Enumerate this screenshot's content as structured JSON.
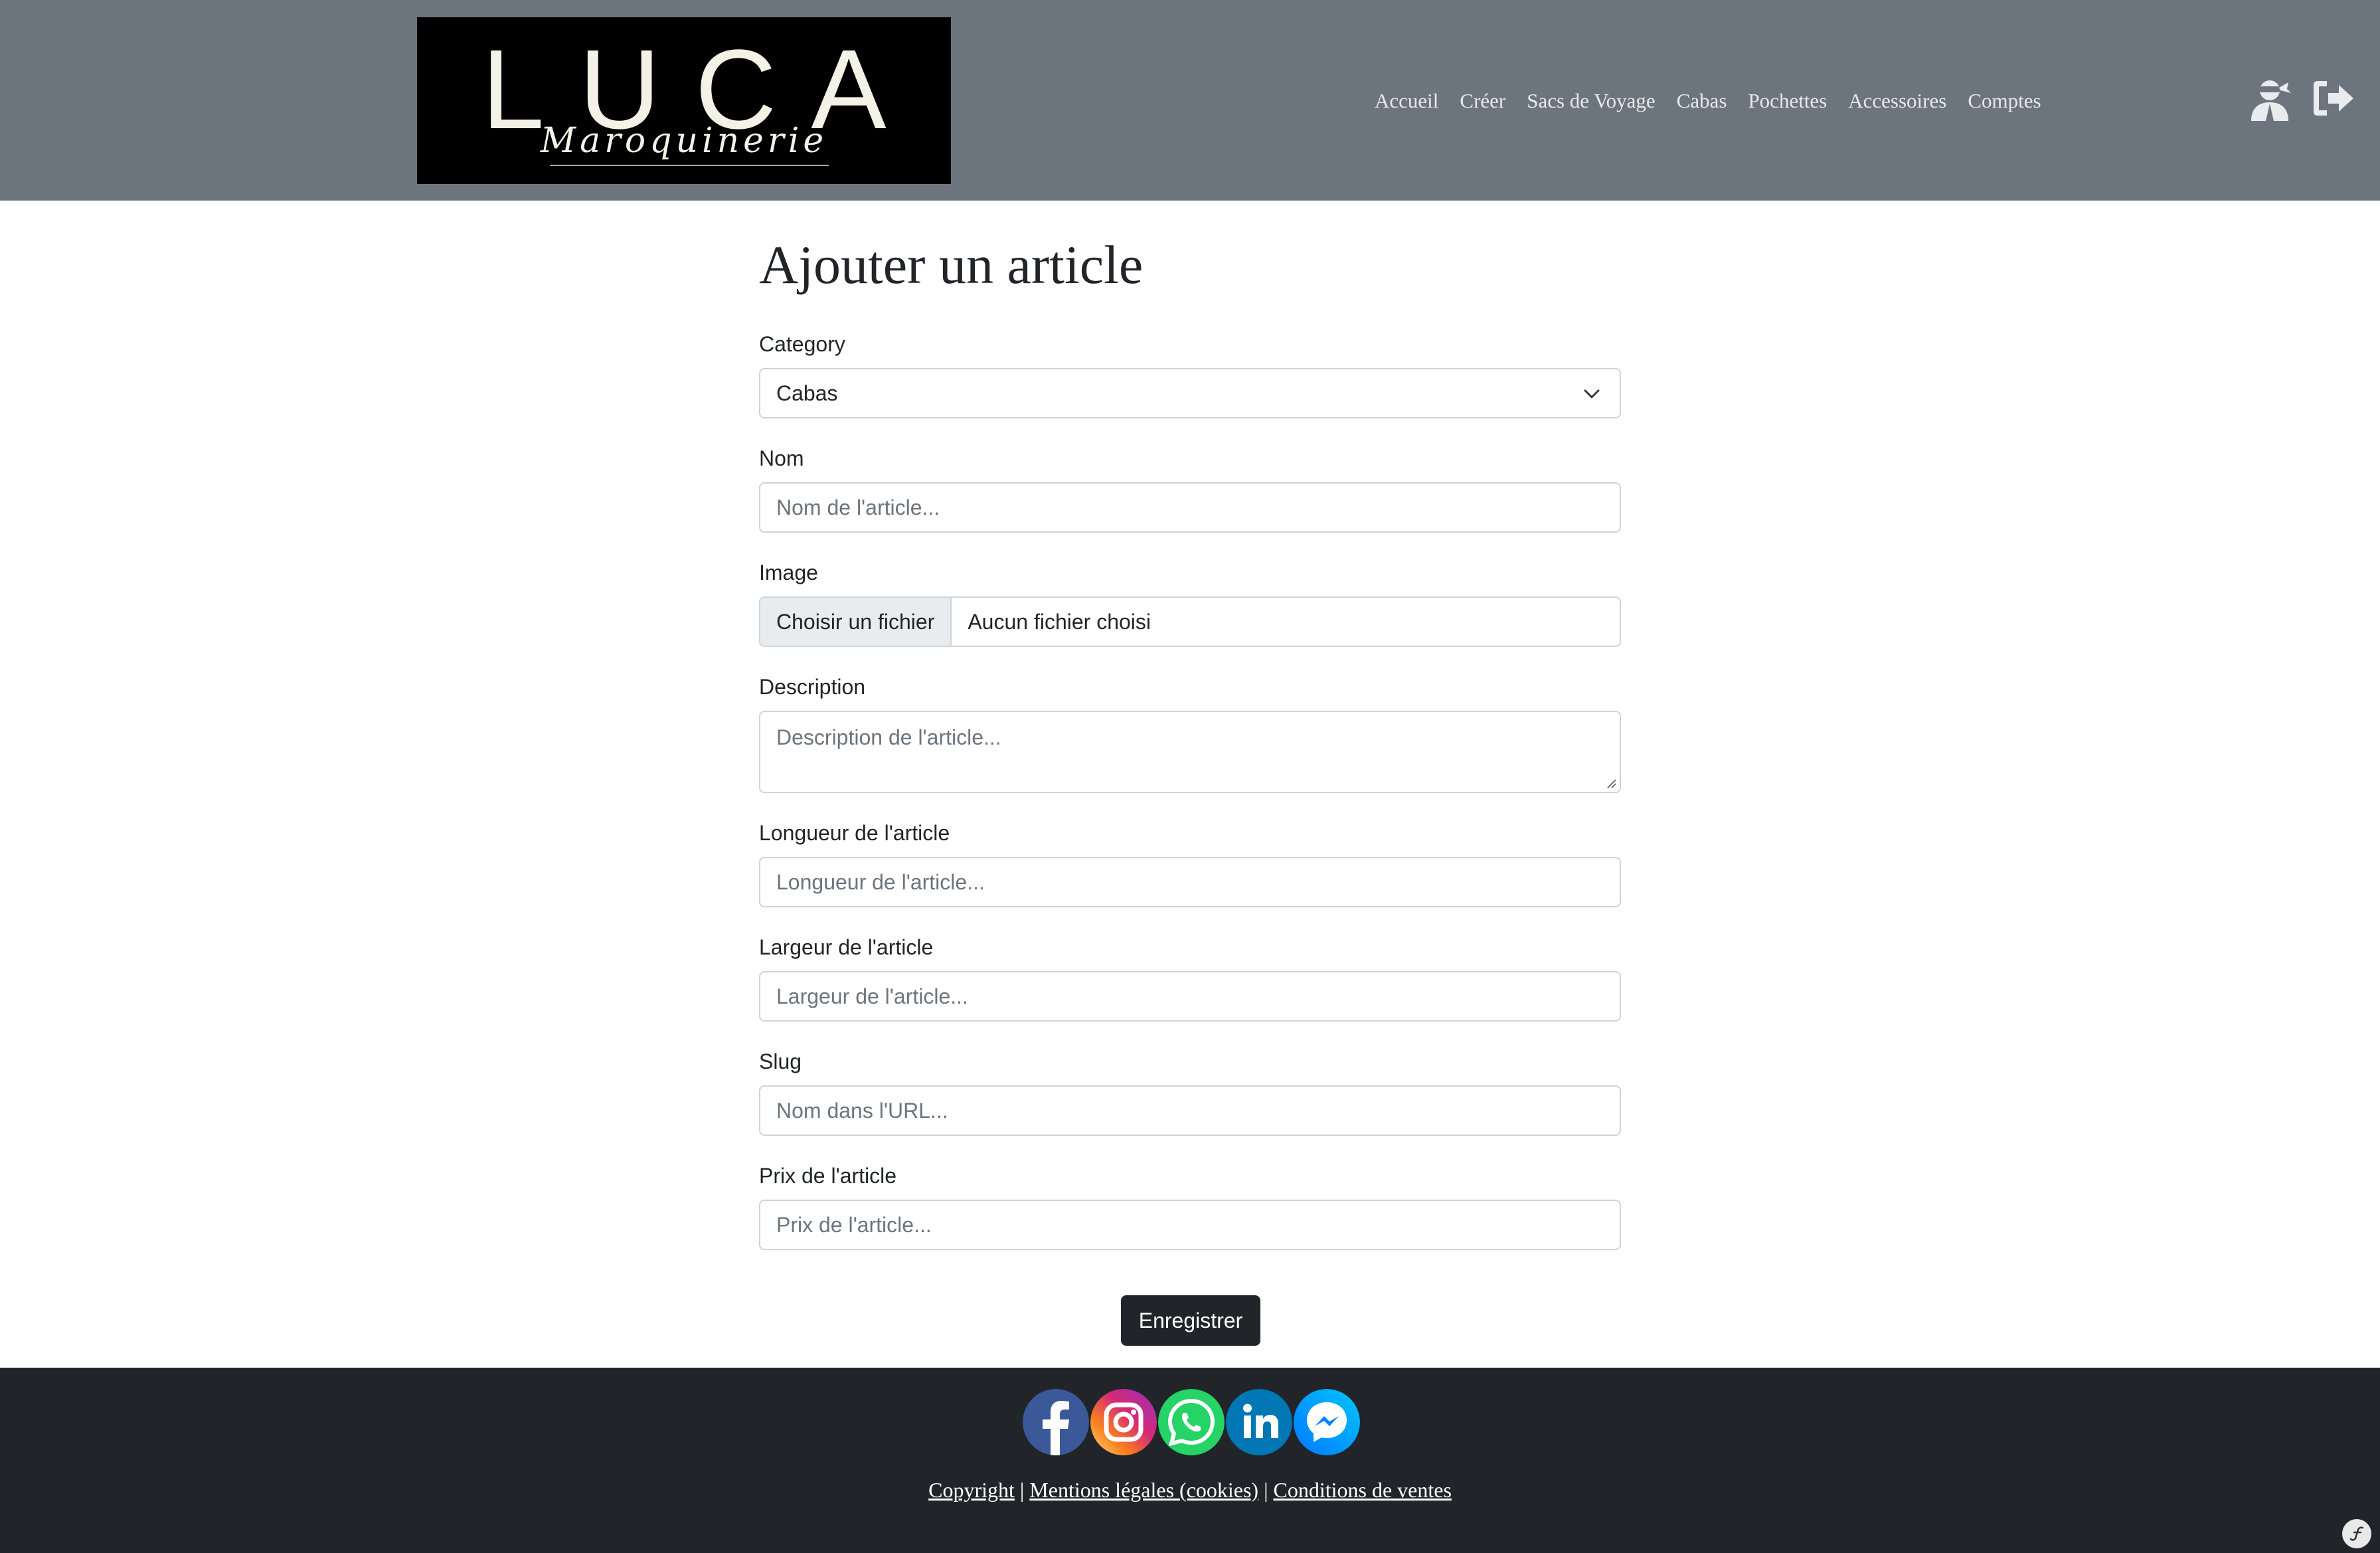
{
  "header": {
    "logo": {
      "wordmark": "LUCA",
      "tagline": "Maroquinerie"
    },
    "nav": [
      {
        "label": "Accueil"
      },
      {
        "label": "Créer"
      },
      {
        "label": "Sacs de Voyage"
      },
      {
        "label": "Cabas"
      },
      {
        "label": "Pochettes"
      },
      {
        "label": "Accessoires"
      },
      {
        "label": "Comptes"
      }
    ],
    "icons": [
      "user-ninja-icon",
      "sign-out-icon"
    ]
  },
  "form": {
    "title": "Ajouter un article",
    "category": {
      "label": "Category",
      "value": "Cabas"
    },
    "nom": {
      "label": "Nom",
      "placeholder": "Nom de l'article..."
    },
    "image": {
      "label": "Image",
      "button": "Choisir un fichier",
      "file_status": "Aucun fichier choisi"
    },
    "description": {
      "label": "Description",
      "placeholder": "Description de l'article..."
    },
    "longueur": {
      "label": "Longueur de l'article",
      "placeholder": "Longueur de l'article..."
    },
    "largeur": {
      "label": "Largeur de l'article",
      "placeholder": "Largeur de l'article..."
    },
    "slug": {
      "label": "Slug",
      "placeholder": "Nom dans l'URL..."
    },
    "prix": {
      "label": "Prix de l'article",
      "placeholder": "Prix de l'article..."
    },
    "submit_label": "Enregistrer"
  },
  "footer": {
    "social": [
      "facebook-icon",
      "instagram-icon",
      "whatsapp-icon",
      "linkedin-icon",
      "messenger-icon"
    ],
    "links": [
      {
        "label": "Copyright"
      },
      {
        "label": "Mentions légales (cookies)"
      },
      {
        "label": "Conditions de ventes"
      }
    ],
    "separator": "|"
  },
  "colors": {
    "header_bg": "#6c757d",
    "footer_bg": "#212529",
    "button_bg": "#212529",
    "input_border": "#ced4da",
    "placeholder": "#6c757d"
  }
}
